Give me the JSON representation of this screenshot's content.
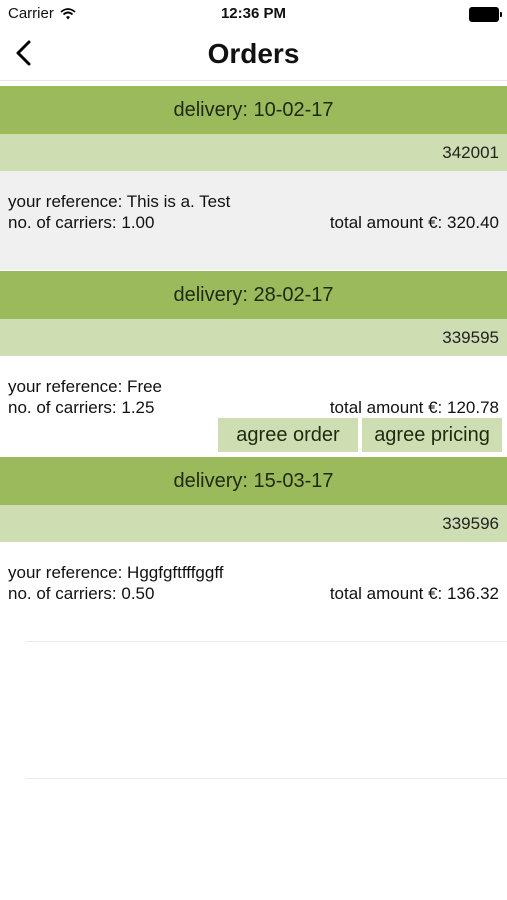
{
  "status_bar": {
    "carrier": "Carrier",
    "time": "12:36 PM"
  },
  "nav": {
    "title": "Orders"
  },
  "orders": [
    {
      "delivery": "delivery: 10-02-17",
      "number": "342001",
      "reference": "your reference: This is a. Test",
      "carriers": "no. of carriers: 1.00",
      "total": "total amount €: 320.40"
    },
    {
      "delivery": "delivery: 28-02-17",
      "number": "339595",
      "reference": "your reference: Free",
      "carriers": "no. of carriers: 1.25",
      "total": "total amount €: 120.78",
      "actions": {
        "agree_order": "agree order",
        "agree_pricing": "agree pricing"
      }
    },
    {
      "delivery": "delivery: 15-03-17",
      "number": "339596",
      "reference": "your reference: Hggfgftfffggff",
      "carriers": "no. of carriers: 0.50",
      "total": "total amount €: 136.32"
    }
  ],
  "colors": {
    "delivery_bar": "#9aba5c",
    "number_bar": "#cfddb2",
    "selected_row": "#f0f0f0"
  }
}
